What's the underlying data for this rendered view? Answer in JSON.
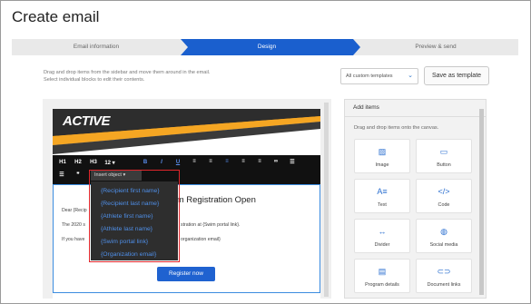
{
  "page": {
    "title": "Create email"
  },
  "stepper": {
    "steps": [
      {
        "label": "Email information"
      },
      {
        "label": "Design"
      },
      {
        "label": "Preview & send"
      }
    ]
  },
  "helper": {
    "line1": "Drag and drop items from the sidebar and move them around in the email.",
    "line2": "Select individual blocks to edit their contents."
  },
  "templates": {
    "selected": "All custom templates",
    "save_label": "Save as template"
  },
  "editor": {
    "logo": "ACTIVE",
    "toolbar": {
      "buttons": [
        "H1",
        "H2",
        "H3",
        "12",
        "B",
        "I",
        "U"
      ],
      "insert_object": "Insert object",
      "quote": "❞"
    },
    "heading": "gram Registration Open",
    "body_lines": [
      "Dear {Recip",
      "The 2020 s",
      "stration at {Swim portal link}.",
      "If you have",
      "organization email}"
    ],
    "button_label": "Register now"
  },
  "insert_menu": {
    "items": [
      "{Recipient first name}",
      "{Recipient last name}",
      "{Athlete first name}",
      "{Athlete last name}",
      "{Swim portal link}",
      "{Organization email}"
    ]
  },
  "sidebar": {
    "title": "Add items",
    "subtitle": "Drag and drop items onto the canvas.",
    "items": [
      {
        "label": "Image",
        "icon": "image-icon"
      },
      {
        "label": "Button",
        "icon": "button-icon"
      },
      {
        "label": "Text",
        "icon": "text-icon"
      },
      {
        "label": "Code",
        "icon": "code-icon"
      },
      {
        "label": "Divider",
        "icon": "divider-icon"
      },
      {
        "label": "Social media",
        "icon": "globe-icon"
      },
      {
        "label": "Program details",
        "icon": "program-icon"
      },
      {
        "label": "Document links",
        "icon": "link-icon"
      }
    ]
  },
  "colors": {
    "accent": "#1f62d0",
    "stepper_active": "#1a5fce",
    "highlight": "#e0262b",
    "banner_orange": "#f39c1f"
  }
}
